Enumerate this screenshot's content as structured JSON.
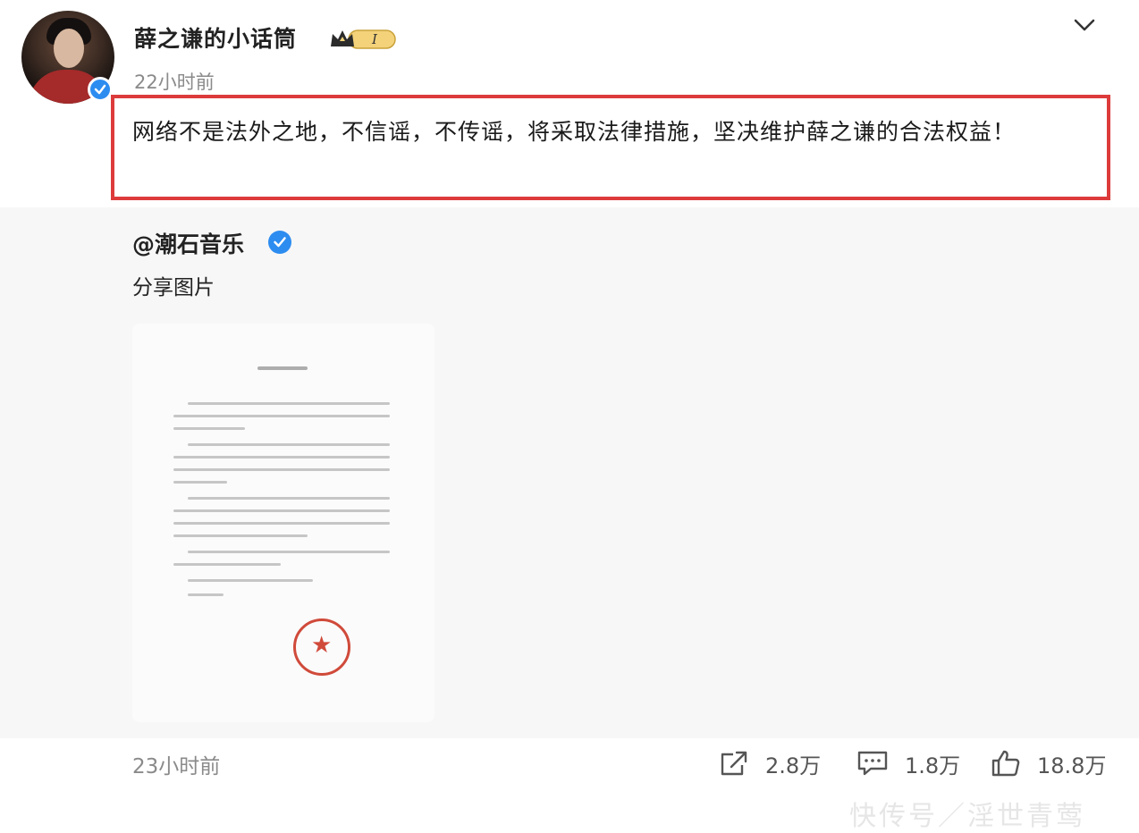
{
  "post": {
    "username": "薛之谦的小话筒",
    "vip_level": "I",
    "time": "22小时前",
    "text": "网络不是法外之地，不信谣，不传谣，将采取法律措施，坚决维护薛之谦的合法权益！"
  },
  "repost": {
    "username": "@潮石音乐",
    "text": "分享图片",
    "time": "23小时前"
  },
  "actions": {
    "share_count": "2.8万",
    "comment_count": "1.8万",
    "like_count": "18.8万"
  },
  "watermark": "快传号／淫世青莺",
  "colors": {
    "highlight_border": "#dd3b3b",
    "verified_blue": "#2d8cf0",
    "seal_red": "#d04a3a"
  }
}
